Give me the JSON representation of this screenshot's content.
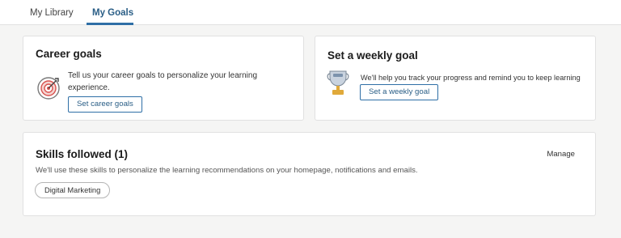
{
  "tabs": [
    {
      "label": "My Library"
    },
    {
      "label": "My Goals"
    }
  ],
  "career": {
    "title": "Career goals",
    "description": "Tell us your career goals to personalize your learning experience.",
    "button_label": "Set career goals",
    "icon": "target-icon"
  },
  "weekly": {
    "title": "Set a weekly goal",
    "description": "We'll help you track your progress and remind you to keep learning",
    "button_label": "Set a weekly goal",
    "icon": "trophy-icon"
  },
  "skills": {
    "title": "Skills followed (1)",
    "manage_label": "Manage",
    "description": "We'll use these skills to personalize the learning recommendations on your homepage, notifications and emails.",
    "items": [
      {
        "label": "Digital Marketing"
      }
    ]
  },
  "colors": {
    "accent": "#2f6fa6",
    "accent_text": "#2a5e86",
    "target_red": "#d9534f",
    "trophy_gold": "#e0a93a"
  }
}
